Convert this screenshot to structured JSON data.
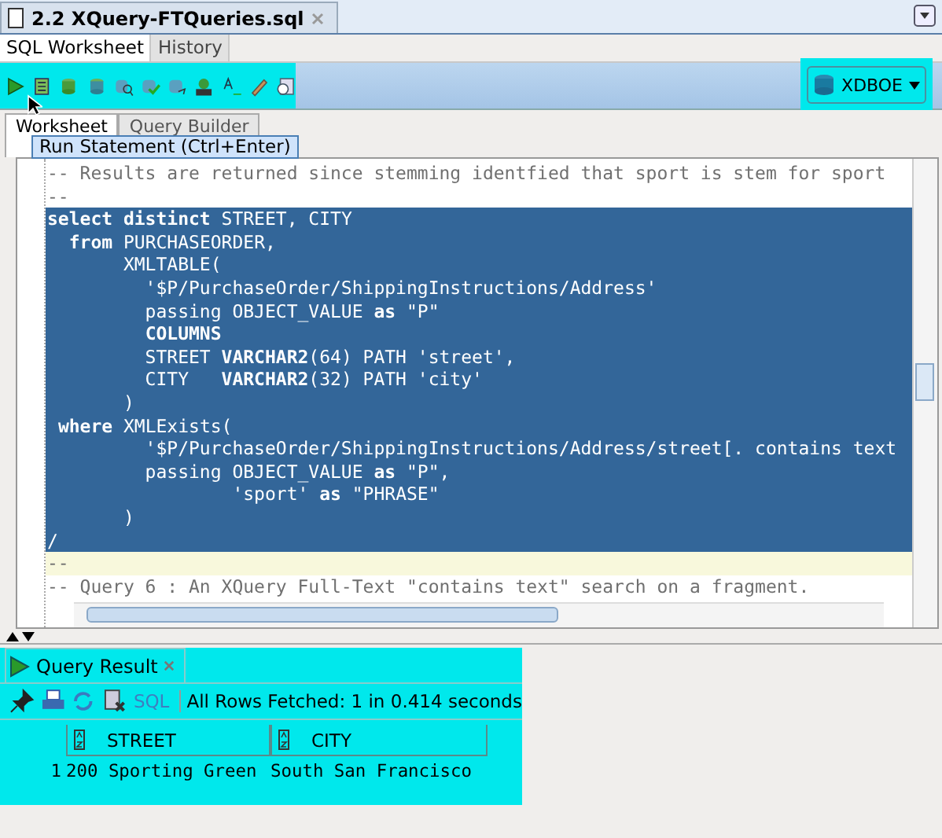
{
  "document_tab": {
    "title": "2.2 XQuery-FTQueries.sql"
  },
  "subtabs": [
    {
      "label": "SQL Worksheet",
      "selected": true
    },
    {
      "label": "History",
      "selected": false
    }
  ],
  "connection": "XDBOE",
  "tooltip": "Run Statement (Ctrl+Enter)",
  "worksheet_tabs": [
    {
      "label": "Worksheet",
      "selected": true
    },
    {
      "label": "Query Builder",
      "selected": false
    }
  ],
  "editor": {
    "lines": [
      {
        "text": "-- Results are returned since stemming identfied that sport is stem for sport",
        "kind": "comment",
        "selected": false
      },
      {
        "text": "--",
        "kind": "comment",
        "selected": false
      },
      {
        "text": "**select distinct** STREET, CITY",
        "kind": "code",
        "selected": true
      },
      {
        "text": "  **from** PURCHASEORDER,",
        "kind": "code",
        "selected": true
      },
      {
        "text": "       XMLTABLE(",
        "kind": "code",
        "selected": true
      },
      {
        "text": "         '$P/PurchaseOrder/ShippingInstructions/Address'",
        "kind": "code",
        "selected": true
      },
      {
        "text": "         passing OBJECT_VALUE **as** \"P\"",
        "kind": "code",
        "selected": true
      },
      {
        "text": "         **COLUMNS**",
        "kind": "code",
        "selected": true
      },
      {
        "text": "         STREET **VARCHAR2**(64) PATH 'street',",
        "kind": "code",
        "selected": true
      },
      {
        "text": "         CITY   **VARCHAR2**(32) PATH 'city'",
        "kind": "code",
        "selected": true
      },
      {
        "text": "       )",
        "kind": "code",
        "selected": true
      },
      {
        "text": " **where** XMLExists(",
        "kind": "code",
        "selected": true
      },
      {
        "text": "         '$P/PurchaseOrder/ShippingInstructions/Address/street[. contains text",
        "kind": "code",
        "selected": true
      },
      {
        "text": "         passing OBJECT_VALUE **as** \"P\",",
        "kind": "code",
        "selected": true
      },
      {
        "text": "                 'sport' **as** \"PHRASE\"",
        "kind": "code",
        "selected": true
      },
      {
        "text": "       )",
        "kind": "code",
        "selected": true
      },
      {
        "text": "/",
        "kind": "code",
        "selected": true
      },
      {
        "text": "--",
        "kind": "current",
        "selected": false
      },
      {
        "text": "-- Query 6 : An XQuery Full-Text \"contains text\" search on a fragment.",
        "kind": "comment",
        "selected": false
      }
    ]
  },
  "result": {
    "tab": "Query Result",
    "sql_link": "SQL",
    "status": "All Rows Fetched: 1 in 0.414 seconds",
    "columns": [
      "STREET",
      "CITY"
    ],
    "rows": [
      {
        "number": "1",
        "cells": [
          "200 Sporting Green",
          "South San Francisco"
        ]
      }
    ]
  }
}
